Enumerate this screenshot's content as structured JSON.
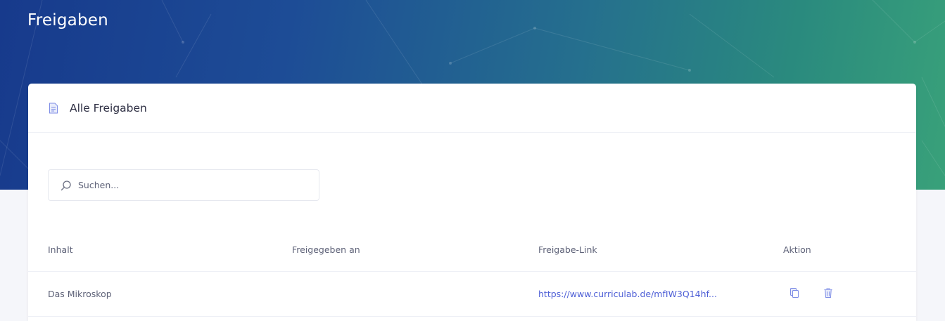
{
  "page": {
    "title": "Freigaben"
  },
  "card": {
    "title": "Alle Freigaben",
    "icon": "document-icon"
  },
  "search": {
    "placeholder": "Suchen...",
    "value": "",
    "icon": "search-icon"
  },
  "table": {
    "headers": [
      "Inhalt",
      "Freigegeben an",
      "Freigabe-Link",
      "Aktion"
    ],
    "rows": [
      {
        "content": "Das Mikroskop",
        "shared_with": "",
        "link": "https://www.curriculab.de/mfIW3Q14hf...",
        "actions": [
          "copy-icon",
          "trash-icon"
        ]
      }
    ]
  },
  "colors": {
    "header_gradient_start": "#173a8c",
    "header_gradient_end": "#39a17a",
    "link": "#4e5fd6",
    "icon_accent": "#6f7fe0"
  }
}
